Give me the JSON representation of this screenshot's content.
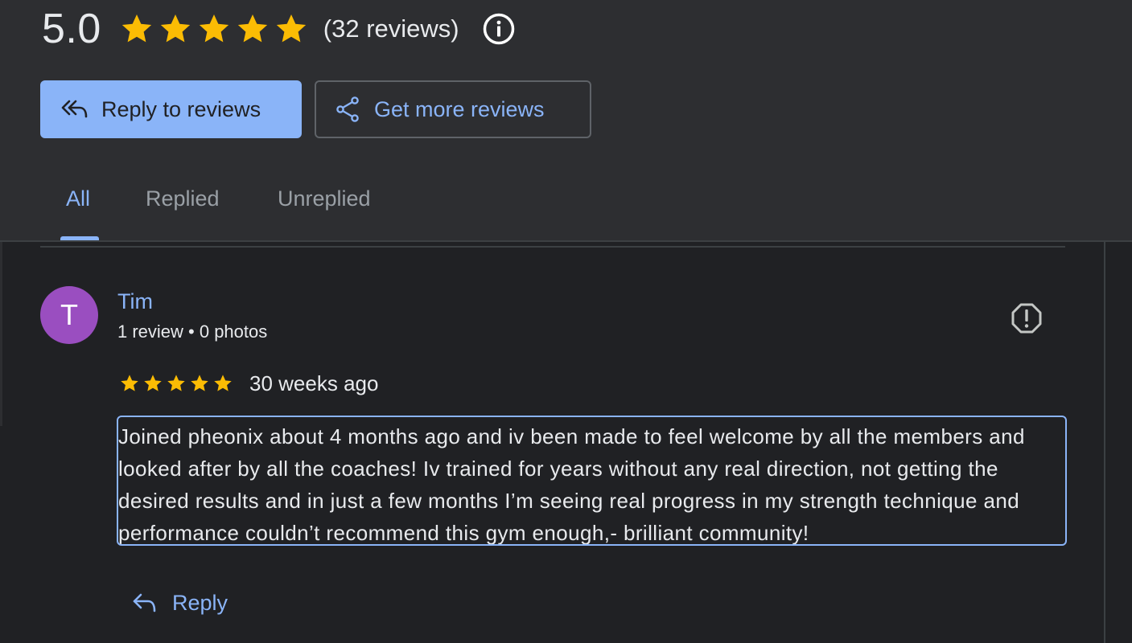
{
  "summary": {
    "rating": "5.0",
    "star_count": 5,
    "review_count_label": "(32 reviews)",
    "info_icon": "info-icon"
  },
  "actions": {
    "reply_to_reviews_label": "Reply to reviews",
    "get_more_reviews_label": "Get more reviews"
  },
  "tabs": [
    {
      "label": "All",
      "selected": true
    },
    {
      "label": "Replied",
      "selected": false
    },
    {
      "label": "Unreplied",
      "selected": false
    }
  ],
  "review": {
    "avatar_letter": "T",
    "avatar_color": "#9a4ec0",
    "author": "Tim",
    "author_meta": "1 review • 0 photos",
    "rating": 5,
    "date": "30 weeks ago",
    "text": "Joined pheonix about 4 months ago and iv been made to feel welcome by all the members and looked after by all the coaches! Iv trained for years without any real direction, not getting the desired results and in just a few months I’m seeing real progress in my strength technique and performance couldn’t recommend this gym enough,- brilliant community!",
    "reply_label": "Reply",
    "flag_icon": "report-flag-icon"
  },
  "colors": {
    "accent": "#8ab4f8",
    "star": "#fbbc04",
    "background": "#202124",
    "header_background": "#2d2e31"
  }
}
